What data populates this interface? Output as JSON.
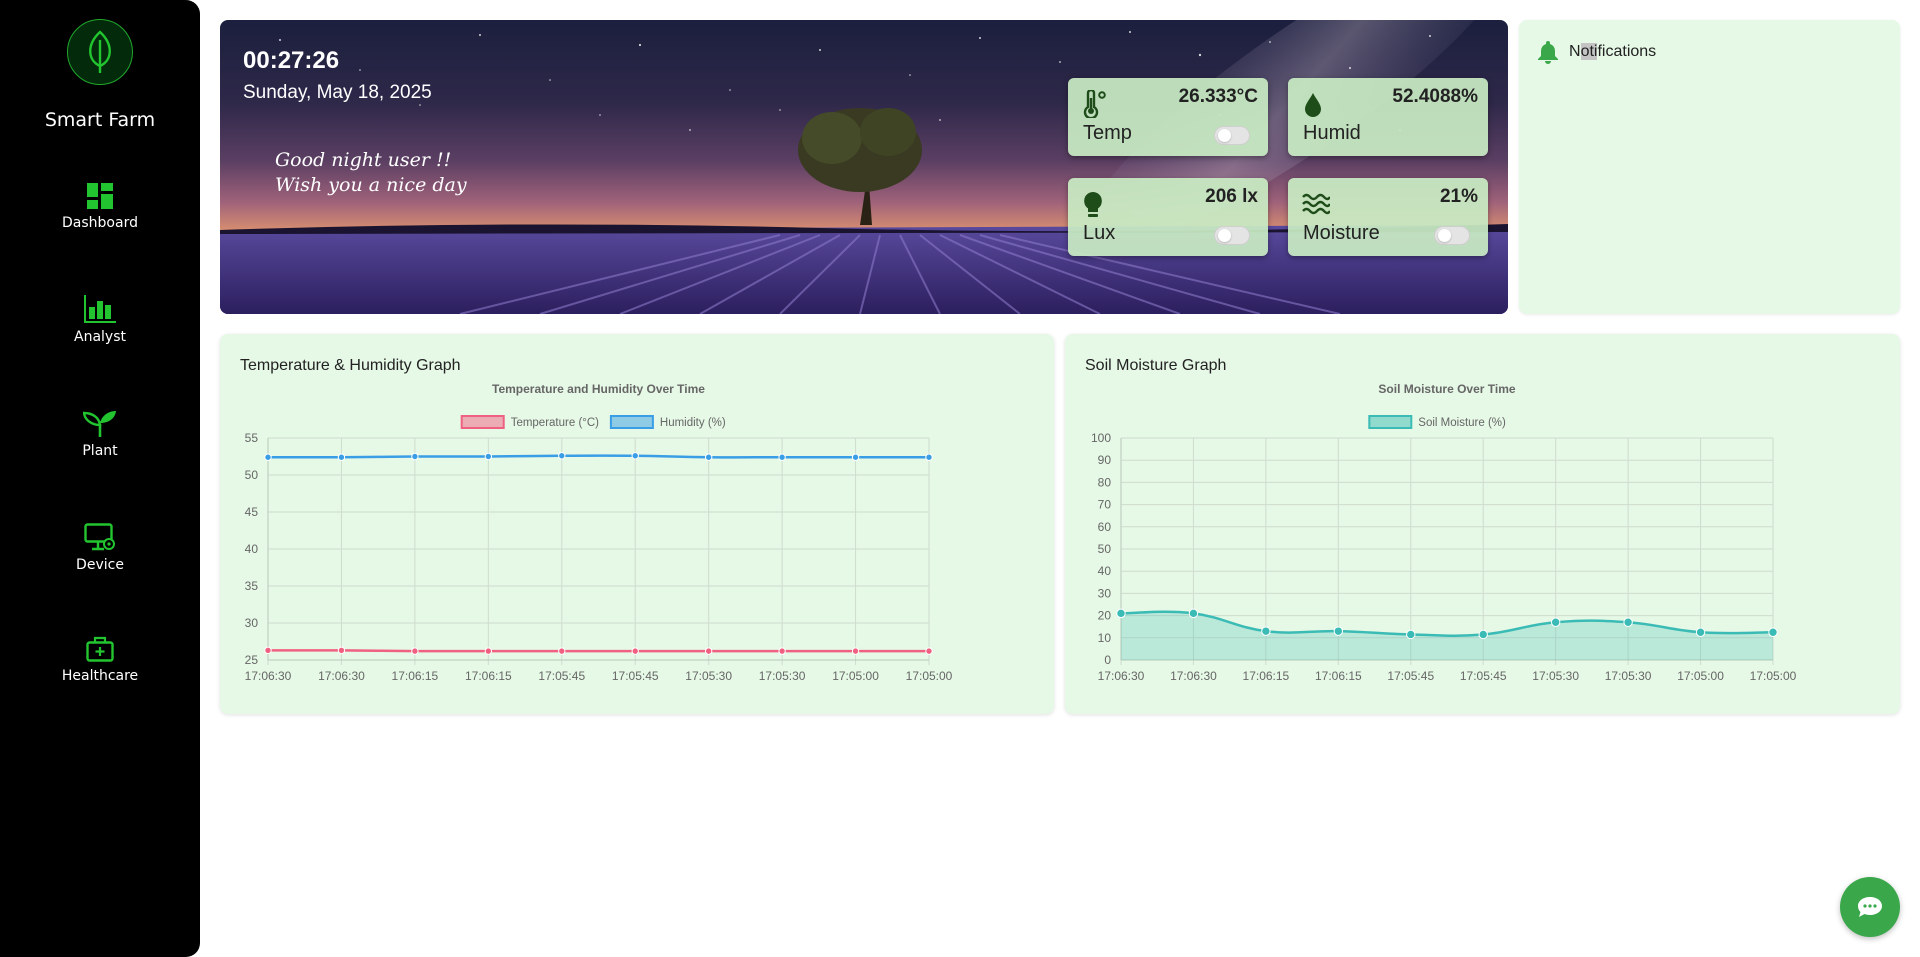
{
  "sidebar": {
    "brand": "Smart Farm",
    "logo_icon": "leaf-icon",
    "items": [
      {
        "label": "Dashboard",
        "icon": "dashboard-icon"
      },
      {
        "label": "Analyst",
        "icon": "bar-chart-icon"
      },
      {
        "label": "Plant",
        "icon": "sprout-icon"
      },
      {
        "label": "Device",
        "icon": "monitor-gear-icon"
      },
      {
        "label": "Healthcare",
        "icon": "medical-kit-icon"
      }
    ],
    "accent_color": "#22c52f"
  },
  "banner": {
    "time": "00:27:26",
    "date": "Sunday, May 18, 2025",
    "greeting_line1": "Good night user !!",
    "greeting_line2": "Wish you a nice day"
  },
  "sensors": {
    "temp": {
      "label": "Temp",
      "value": "26.333°C",
      "icon": "thermometer-icon",
      "toggle_on": false
    },
    "humid": {
      "label": "Humid",
      "value": "52.4088%",
      "icon": "water-drop-icon"
    },
    "lux": {
      "label": "Lux",
      "value": "206 lx",
      "icon": "lightbulb-icon",
      "toggle_on": false
    },
    "moisture": {
      "label": "Moisture",
      "value": "21%",
      "icon": "waves-icon",
      "toggle_on": false
    }
  },
  "notifications": {
    "title_highlight_before": "N",
    "title_highlight": "oti",
    "title_highlight_after": "fications",
    "icon": "bell-icon"
  },
  "graphs": {
    "temp_humid_title": "Temperature & Humidity Graph",
    "soil_title": "Soil Moisture Graph"
  },
  "chart_data": [
    {
      "type": "line",
      "title": "Temperature and Humidity Over Time",
      "categories": [
        "17:06:30",
        "17:06:30",
        "17:06:15",
        "17:06:15",
        "17:05:45",
        "17:05:45",
        "17:05:30",
        "17:05:30",
        "17:05:00",
        "17:05:00"
      ],
      "series": [
        {
          "name": "Temperature (°C)",
          "color": "#f06080",
          "values": [
            26.3,
            26.3,
            26.2,
            26.2,
            26.2,
            26.2,
            26.2,
            26.2,
            26.2,
            26.2
          ]
        },
        {
          "name": "Humidity (%)",
          "color": "#3a9ee6",
          "values": [
            52.4,
            52.4,
            52.5,
            52.5,
            52.6,
            52.6,
            52.4,
            52.4,
            52.4,
            52.4
          ]
        }
      ],
      "yticks": [
        25,
        30,
        35,
        40,
        45,
        50,
        55
      ],
      "ylim": [
        25,
        55
      ],
      "grid": true,
      "legend": "top"
    },
    {
      "type": "area",
      "title": "Soil Moisture Over Time",
      "categories": [
        "17:06:30",
        "17:06:30",
        "17:06:15",
        "17:06:15",
        "17:05:45",
        "17:05:45",
        "17:05:30",
        "17:05:30",
        "17:05:00",
        "17:05:00"
      ],
      "series": [
        {
          "name": "Soil Moisture (%)",
          "color": "#3bbbb5",
          "values": [
            21,
            21,
            13,
            13,
            11.5,
            11.5,
            17,
            17,
            12.5,
            12.5
          ]
        }
      ],
      "yticks": [
        0,
        10,
        20,
        30,
        40,
        50,
        60,
        70,
        80,
        90,
        100
      ],
      "ylim": [
        0,
        100
      ],
      "grid": true,
      "legend": "top"
    }
  ],
  "chat": {
    "icon": "chat-bubble-icon"
  }
}
